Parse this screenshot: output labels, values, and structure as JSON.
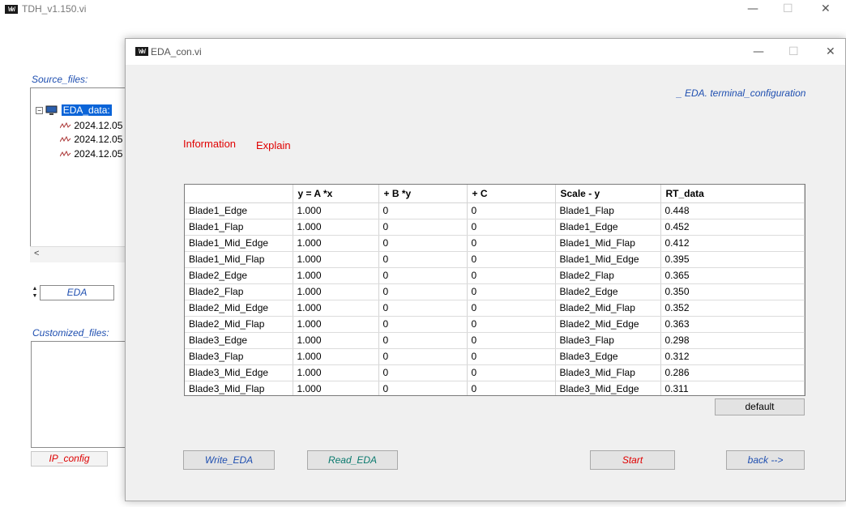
{
  "main_window": {
    "title": "TDH_v1.150.vi",
    "app_icon_text": "WW",
    "controls": {
      "minimize": "—",
      "maximize": "☐",
      "close": "✕"
    },
    "source_files_label": "Source_files:",
    "tree": {
      "root_label": "EDA_data:",
      "items": [
        "2024.12.05",
        "2024.12.05",
        "2024.12.05"
      ]
    },
    "eda_field_value": "EDA",
    "customized_files_label": "Customized_files:",
    "ip_config_label": "IP_config"
  },
  "dialog": {
    "title": "EDA_con.vi",
    "controls": {
      "minimize": "—",
      "maximize": "☐",
      "close": "✕"
    },
    "terminal_config_label": "_ EDA. terminal_configuration",
    "information_label": "Information",
    "explain_label": "Explain",
    "table": {
      "columns": [
        "",
        "y = A *x",
        "+ B *y",
        "+ C",
        "Scale - y",
        "RT_data"
      ],
      "rows": [
        [
          "Blade1_Edge",
          "1.000",
          "0",
          "0",
          "Blade1_Flap",
          "0.448"
        ],
        [
          "Blade1_Flap",
          "1.000",
          "0",
          "0",
          "Blade1_Edge",
          "0.452"
        ],
        [
          "Blade1_Mid_Edge",
          "1.000",
          "0",
          "0",
          "Blade1_Mid_Flap",
          "0.412"
        ],
        [
          "Blade1_Mid_Flap",
          "1.000",
          "0",
          "0",
          "Blade1_Mid_Edge",
          "0.395"
        ],
        [
          "Blade2_Edge",
          "1.000",
          "0",
          "0",
          "Blade2_Flap",
          "0.365"
        ],
        [
          "Blade2_Flap",
          "1.000",
          "0",
          "0",
          "Blade2_Edge",
          "0.350"
        ],
        [
          "Blade2_Mid_Edge",
          "1.000",
          "0",
          "0",
          "Blade2_Mid_Flap",
          "0.352"
        ],
        [
          "Blade2_Mid_Flap",
          "1.000",
          "0",
          "0",
          "Blade2_Mid_Edge",
          "0.363"
        ],
        [
          "Blade3_Edge",
          "1.000",
          "0",
          "0",
          "Blade3_Flap",
          "0.298"
        ],
        [
          "Blade3_Flap",
          "1.000",
          "0",
          "0",
          "Blade3_Edge",
          "0.312"
        ],
        [
          "Blade3_Mid_Edge",
          "1.000",
          "0",
          "0",
          "Blade3_Mid_Flap",
          "0.286"
        ],
        [
          "Blade3_Mid_Flap",
          "1.000",
          "0",
          "0",
          "Blade3_Mid_Edge",
          "0.311"
        ]
      ]
    },
    "default_button": "default",
    "write_eda_button": "Write_EDA",
    "read_eda_button": "Read_EDA",
    "start_button": "Start",
    "back_button": "back -->"
  },
  "icons": {
    "app": "labview-app-icon",
    "tree_root": "computer-icon",
    "tree_item": "waveform-icon"
  },
  "colors": {
    "accent_blue": "#1f4fb0",
    "alert_red": "#e00000",
    "teal": "#0a7a6e",
    "selection": "#0a64d8"
  }
}
